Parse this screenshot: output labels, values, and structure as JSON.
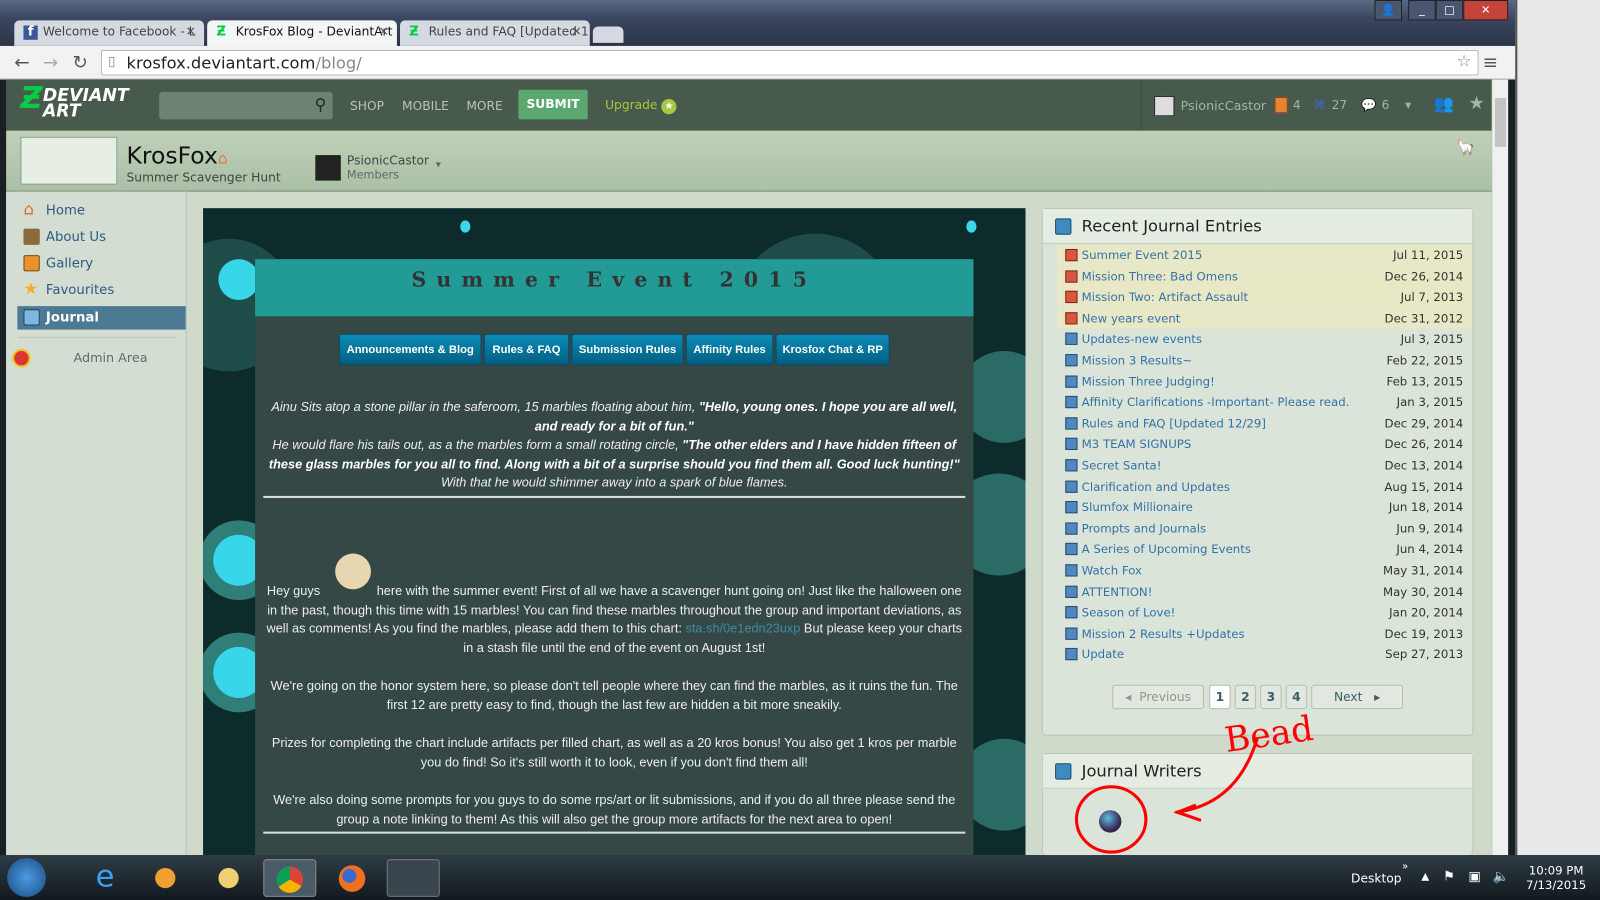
{
  "browser": {
    "tabs": [
      {
        "label": "Welcome to Facebook - L",
        "icon": "facebook-icon"
      },
      {
        "label": "KrosFox Blog - DeviantArt",
        "icon": "deviantart-icon"
      },
      {
        "label": "Rules and FAQ [Updated 1",
        "icon": "deviantart-icon"
      }
    ],
    "url_host": "krosfox.deviantart.com",
    "url_path": "/blog/"
  },
  "da": {
    "logo_line1": "DEVIANT",
    "logo_line2": "ART",
    "nav": [
      "SHOP",
      "MOBILE",
      "MORE"
    ],
    "submit": "SUBMIT",
    "upgrade": "Upgrade",
    "username": "PsionicCastor",
    "deviations_count": "4",
    "watch_count": "27",
    "comments_count": "6"
  },
  "group": {
    "name": "KrosFox",
    "tagline": "Summer Scavenger Hunt",
    "member_name": "PsionicCastor",
    "member_role": "Members"
  },
  "sidebar": {
    "items": [
      "Home",
      "About Us",
      "Gallery",
      "Favourites",
      "Journal"
    ],
    "admin": "Admin Area"
  },
  "journal": {
    "title": "Summer Event 2015",
    "buttons": [
      "Announcements & Blog",
      "Rules & FAQ",
      "Submission Rules",
      "Affinity Rules",
      "Krosfox Chat & RP"
    ],
    "intro1_plain": "Ainu Sits atop a stone pillar in the saferoom, 15 marbles floating about him, ",
    "intro1_bold": "\"Hello, young ones. I hope you are all well, and ready for a bit of fun.\"",
    "intro2_plain": "He would flare his tails out, as a the marbles form a small rotating circle, ",
    "intro2_bold": "\"The other elders and I have hidden fifteen of these glass marbles for you all to find. Along with a bit of a surprise should you find them all. Good luck hunting!\"",
    "intro2_end": "  With that he would shimmer away into a spark of blue flames.",
    "p1_start": "Hey guys",
    "p1_mid": " here with the summer event! First of all we have a scavenger hunt going on! Just like the halloween one in the past, though this time with 15 marbles! You can find these marbles throughout the group and important deviations, as well as comments! As you find the marbles, please add them to this chart:  ",
    "p1_link": "sta.sh/0e1edn23uxp",
    "p1_end": " But please keep your charts in a stash file until the end of the event on August 1st!",
    "p2": "We're going on the honor system here, so please don't tell people where they can find the marbles, as it ruins the fun. The first 12 are pretty easy to find, though the last few are hidden a bit more sneakily.",
    "p3": "Prizes for completing the chart include artifacts per filled chart, as well as a 20 kros bonus! You also get 1 kros per marble you do find! So it's still worth it to look, even if you don't find them all!",
    "p4": "We're also doing some prompts for you guys to do some rps/art or lit submissions, and if you do all three please send the group a note linking to them! As this will also get the group more artifacts for the next area to open!"
  },
  "recent": {
    "title": "Recent Journal Entries",
    "entries": [
      {
        "title": "Summer Event 2015",
        "date": "Jul 11, 2015"
      },
      {
        "title": "Mission Three: Bad Omens",
        "date": "Dec 26, 2014"
      },
      {
        "title": "Mission Two: Artifact Assault",
        "date": "Jul 7, 2013"
      },
      {
        "title": "New years event",
        "date": "Dec 31, 2012"
      },
      {
        "title": "Updates-new events",
        "date": "Jul 3, 2015"
      },
      {
        "title": "Mission 3 Results~",
        "date": "Feb 22, 2015"
      },
      {
        "title": "Mission Three Judging!",
        "date": "Feb 13, 2015"
      },
      {
        "title": "Affinity Clarifications -Important- Please read.",
        "date": "Jan 3, 2015"
      },
      {
        "title": "Rules and FAQ [Updated 12/29]",
        "date": "Dec 29, 2014"
      },
      {
        "title": "M3 TEAM SIGNUPS",
        "date": "Dec 26, 2014"
      },
      {
        "title": "Secret Santa!",
        "date": "Dec 13, 2014"
      },
      {
        "title": "Clarification and Updates",
        "date": "Aug 15, 2014"
      },
      {
        "title": "Slumfox Millionaire",
        "date": "Jun 18, 2014"
      },
      {
        "title": "Prompts and Journals",
        "date": "Jun 9, 2014"
      },
      {
        "title": "A Series of Upcoming Events",
        "date": "Jun 4, 2014"
      },
      {
        "title": "Watch Fox",
        "date": "May 31, 2014"
      },
      {
        "title": "ATTENTION!",
        "date": "May 30, 2014"
      },
      {
        "title": "Season of Love!",
        "date": "Jan 20, 2014"
      },
      {
        "title": "Mission 2 Results +Updates",
        "date": "Dec 19, 2013"
      },
      {
        "title": "Update",
        "date": "Sep 27, 2013"
      }
    ],
    "prev": "Previous",
    "next": "Next",
    "pages": [
      "1",
      "2",
      "3",
      "4"
    ],
    "current_page": 1
  },
  "writers": {
    "title": "Journal Writers"
  },
  "annotation": "Bead",
  "taskbar": {
    "desktop": "Desktop",
    "time": "10:09 PM",
    "date": "7/13/2015"
  }
}
